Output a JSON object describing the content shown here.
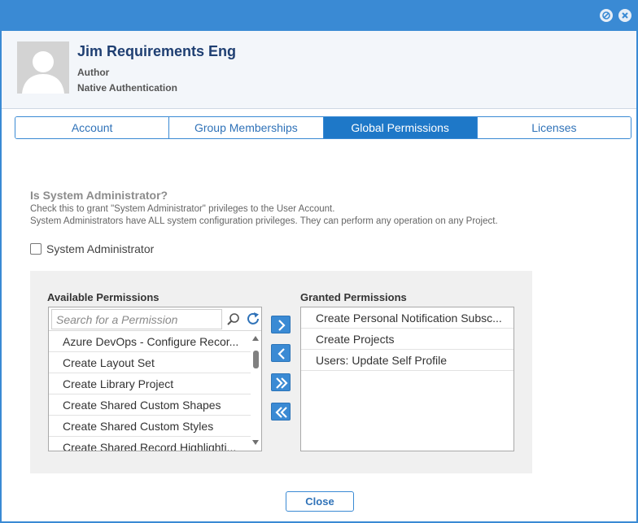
{
  "user": {
    "name": "Jim Requirements Eng",
    "role": "Author",
    "auth": "Native Authentication"
  },
  "tabs": [
    {
      "label": "Account",
      "active": false
    },
    {
      "label": "Group Memberships",
      "active": false
    },
    {
      "label": "Global Permissions",
      "active": true
    },
    {
      "label": "Licenses",
      "active": false
    }
  ],
  "sysadmin": {
    "title": "Is System Administrator?",
    "desc_line1": "Check this to grant \"System Administrator\" privileges to the User Account.",
    "desc_line2": "System Administrators have ALL system configuration privileges. They can perform any operation on any Project.",
    "checkbox_label": "System Administrator",
    "checked": false
  },
  "available": {
    "label": "Available Permissions",
    "search_placeholder": "Search for a Permission",
    "items": [
      "Azure DevOps - Configure Recor...",
      "Create Layout Set",
      "Create Library Project",
      "Create Shared Custom Shapes",
      "Create Shared Custom Styles",
      "Create Shared Record Highlighti..."
    ]
  },
  "granted": {
    "label": "Granted Permissions",
    "items": [
      "Create Personal Notification Subsc...",
      "Create Projects",
      "Users: Update Self Profile"
    ]
  },
  "close_label": "Close",
  "colors": {
    "accent": "#3a8ad4",
    "tab_active": "#1e78c8",
    "name": "#1f3f72"
  }
}
